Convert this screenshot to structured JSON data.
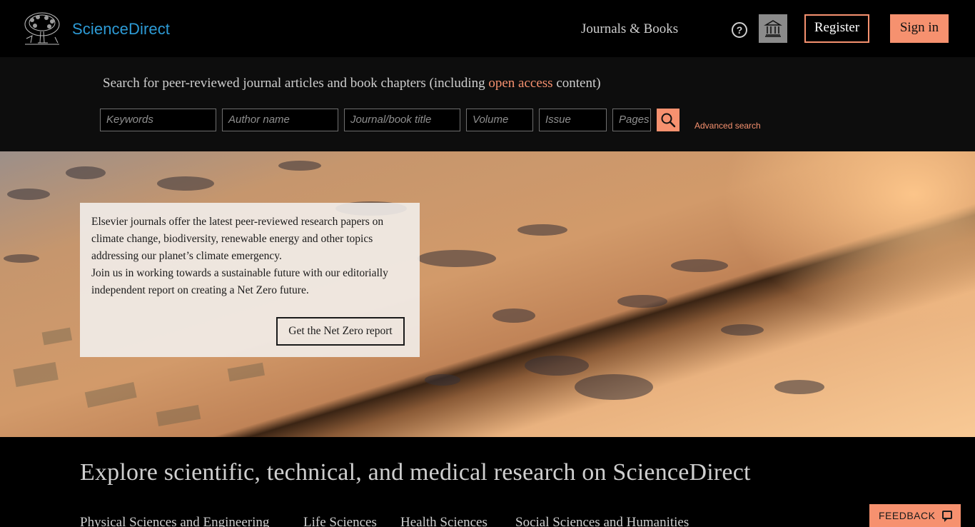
{
  "header": {
    "brand": "ScienceDirect",
    "nav_journals": "Journals & Books",
    "help_symbol": "?",
    "register": "Register",
    "sign_in": "Sign in"
  },
  "search": {
    "caption_before": "Search for peer-reviewed journal articles and book chapters (including ",
    "caption_link": "open access",
    "caption_after": " content)",
    "fields": {
      "keywords": "Keywords",
      "author": "Author name",
      "journal": "Journal/book title",
      "volume": "Volume",
      "issue": "Issue",
      "pages": "Pages"
    },
    "advanced": "Advanced search"
  },
  "hero": {
    "text_line1": "Elsevier journals offer the latest peer-reviewed research papers on climate change, biodiversity, renewable energy and other topics addressing our planet’s climate emergency.",
    "text_line2": "Join us in working towards a sustainable future with our editorially independent report on creating a Net Zero future.",
    "button": "Get the Net Zero report"
  },
  "explore": {
    "heading": "Explore scientific, technical, and medical research on ScienceDirect",
    "categories": [
      "Physical Sciences and Engineering",
      "Life Sciences",
      "Health Sciences",
      "Social Sciences and Humanities"
    ]
  },
  "feedback": "FEEDBACK",
  "colors": {
    "accent": "#f6916f",
    "brand": "#2d9bd6"
  }
}
